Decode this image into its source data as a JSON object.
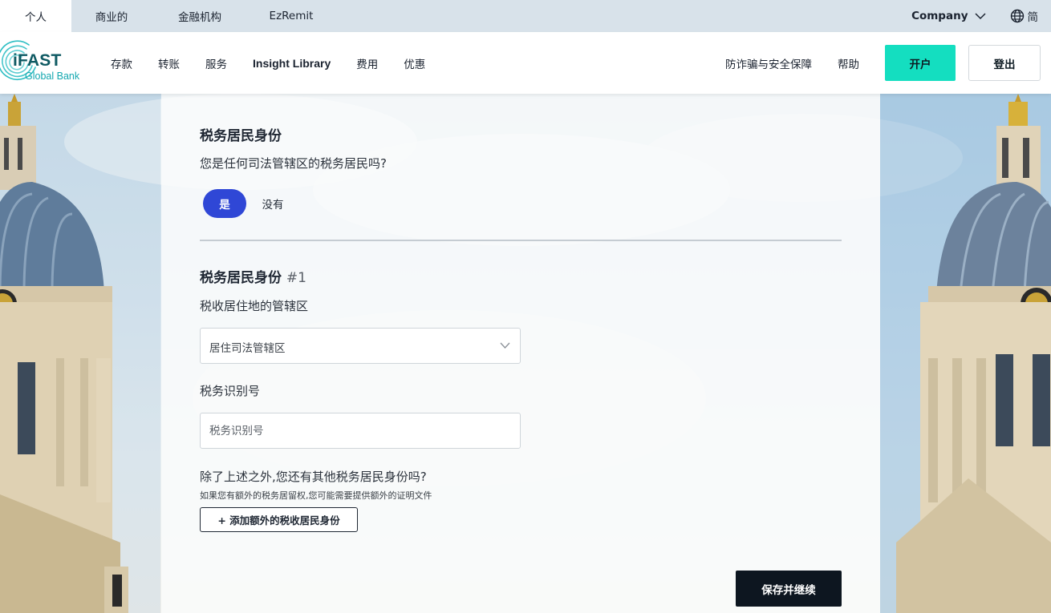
{
  "top_tabs": [
    "个人",
    "商业的",
    "金融机构",
    "EzRemit"
  ],
  "company_label": "Company",
  "lang_label": "简",
  "logo": {
    "line1": "iFAST",
    "line2": "Global Bank"
  },
  "nav": {
    "items": [
      "存款",
      "转账",
      "服务",
      "Insight Library",
      "费用",
      "优惠"
    ],
    "fraud": "防诈骗与安全保障",
    "help": "帮助",
    "open_account": "开户",
    "logout": "登出"
  },
  "form": {
    "section_title": "税务居民身份",
    "question": "您是任何司法管辖区的税务居民吗?",
    "yes_label": "是",
    "no_label": "没有",
    "sub_title": "税务居民身份",
    "sub_title_num": "#1",
    "jurisdiction_label": "税收居住地的管辖区",
    "jurisdiction_value": "居住司法管辖区",
    "tin_label": "税务识别号",
    "tin_placeholder": "税务识别号",
    "extra_question": "除了上述之外,您还有其他税务居民身份吗?",
    "extra_note": "如果您有额外的税务居留权,您可能需要提供额外的证明文件",
    "add_button": "+ 添加额外的税收居民身份",
    "save_button": "保存并继续"
  },
  "colors": {
    "accent_blue": "#2f47d6",
    "open_button": "#14dec0",
    "save_button": "#0d1620"
  }
}
